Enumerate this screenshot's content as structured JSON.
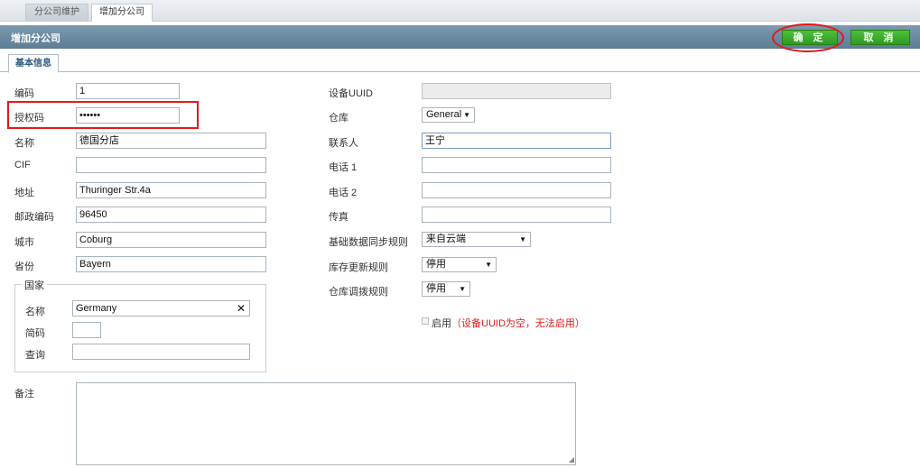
{
  "top_tabs": [
    "分公司维护",
    "增加分公司"
  ],
  "header": {
    "title": "增加分公司",
    "confirm": "确 定",
    "cancel": "取 消"
  },
  "subtab": "基本信息",
  "left": {
    "code": {
      "label": "编码",
      "value": "1"
    },
    "auth": {
      "label": "授权码",
      "value": "••••••"
    },
    "name": {
      "label": "名称",
      "value": "德国分店"
    },
    "cif": {
      "label": "CIF",
      "value": ""
    },
    "address": {
      "label": "地址",
      "value": "Thuringer Str.4a"
    },
    "postcode": {
      "label": "邮政编码",
      "value": "96450"
    },
    "city": {
      "label": "城市",
      "value": "Coburg"
    },
    "province": {
      "label": "省份",
      "value": "Bayern"
    }
  },
  "country": {
    "legend": "国家",
    "name_label": "名称",
    "name_value": "Germany",
    "short_label": "简码",
    "short_value": "",
    "query_label": "查询",
    "query_value": "",
    "clear_icon": "✕"
  },
  "right": {
    "uuid": {
      "label": "设备UUID",
      "value": ""
    },
    "warehouse": {
      "label": "仓库",
      "value": "General"
    },
    "contact": {
      "label": "联系人",
      "value": "王宁"
    },
    "phone1": {
      "label": "电话 1",
      "value": ""
    },
    "phone2": {
      "label": "电话 2",
      "value": ""
    },
    "fax": {
      "label": "传真",
      "value": ""
    },
    "sync_rule": {
      "label": "基础数据同步规则",
      "value": "来自云端"
    },
    "stock_rule": {
      "label": "库存更新规则",
      "value": "停用"
    },
    "transfer_rule": {
      "label": "仓库调拨规则",
      "value": "停用"
    }
  },
  "enable": {
    "label": "启用",
    "warning": "（设备UUID为空，无法启用）"
  },
  "remark": {
    "label": "备注",
    "value": ""
  },
  "colors": {
    "header": "#6a89a0",
    "button": "#3aad2c",
    "highlight": "#e21a1a"
  }
}
